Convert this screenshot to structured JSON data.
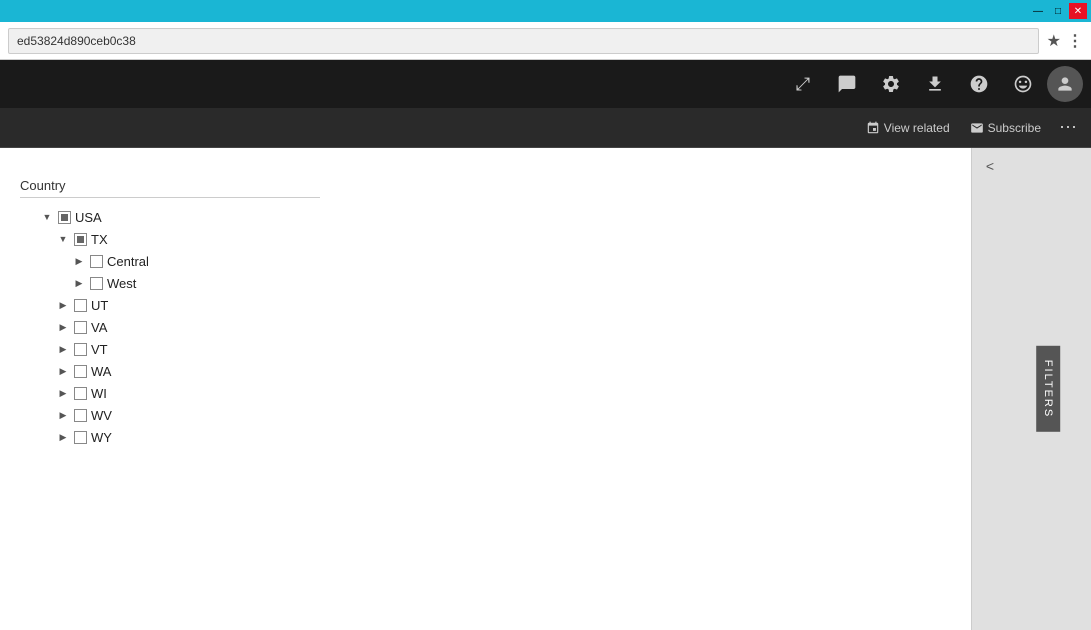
{
  "titlebar": {
    "controls": {
      "minimize": "—",
      "maximize": "□",
      "close": "✕"
    }
  },
  "addressbar": {
    "url": "ed53824d890ceb0c38",
    "star_icon": "★",
    "menu_icon": "⋮"
  },
  "toolbar": {
    "icons": [
      {
        "name": "expand-icon",
        "glyph": "⤢"
      },
      {
        "name": "chat-icon",
        "glyph": "💬"
      },
      {
        "name": "settings-icon",
        "glyph": "⚙"
      },
      {
        "name": "download-icon",
        "glyph": "⬇"
      },
      {
        "name": "help-icon",
        "glyph": "?"
      },
      {
        "name": "emoji-icon",
        "glyph": "☺"
      }
    ],
    "avatar_icon": "👤"
  },
  "actionbar": {
    "view_related_label": "View related",
    "subscribe_label": "Subscribe",
    "more_icon": "⋯"
  },
  "tree": {
    "label": "Country",
    "nodes": [
      {
        "id": "usa",
        "text": "USA",
        "indent": 1,
        "expanded": true,
        "checked": "partial",
        "children": [
          {
            "id": "tx",
            "text": "TX",
            "indent": 2,
            "expanded": true,
            "checked": "partial",
            "children": [
              {
                "id": "central",
                "text": "Central",
                "indent": 3,
                "expanded": false,
                "checked": "unchecked"
              },
              {
                "id": "west",
                "text": "West",
                "indent": 3,
                "expanded": false,
                "checked": "unchecked"
              }
            ]
          },
          {
            "id": "ut",
            "text": "UT",
            "indent": 2,
            "expanded": false,
            "checked": "unchecked"
          },
          {
            "id": "va",
            "text": "VA",
            "indent": 2,
            "expanded": false,
            "checked": "unchecked"
          },
          {
            "id": "vt",
            "text": "VT",
            "indent": 2,
            "expanded": false,
            "checked": "unchecked"
          },
          {
            "id": "wa",
            "text": "WA",
            "indent": 2,
            "expanded": false,
            "checked": "unchecked"
          },
          {
            "id": "wi",
            "text": "WI",
            "indent": 2,
            "expanded": false,
            "checked": "unchecked"
          },
          {
            "id": "wv",
            "text": "WV",
            "indent": 2,
            "expanded": false,
            "checked": "unchecked"
          },
          {
            "id": "wy",
            "text": "WY",
            "indent": 2,
            "expanded": false,
            "checked": "unchecked"
          }
        ]
      }
    ]
  },
  "filters": {
    "tab_label": "FILTERS",
    "collapse_icon": "<"
  }
}
